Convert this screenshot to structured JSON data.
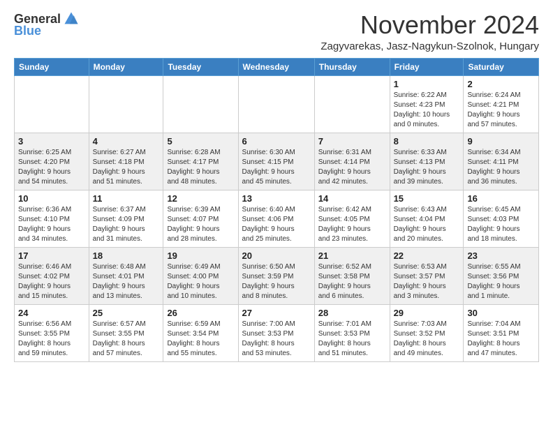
{
  "header": {
    "logo_general": "General",
    "logo_blue": "Blue",
    "month_title": "November 2024",
    "subtitle": "Zagyvarekas, Jasz-Nagykun-Szolnok, Hungary"
  },
  "days_of_week": [
    "Sunday",
    "Monday",
    "Tuesday",
    "Wednesday",
    "Thursday",
    "Friday",
    "Saturday"
  ],
  "weeks": [
    [
      {
        "day": "",
        "info": ""
      },
      {
        "day": "",
        "info": ""
      },
      {
        "day": "",
        "info": ""
      },
      {
        "day": "",
        "info": ""
      },
      {
        "day": "",
        "info": ""
      },
      {
        "day": "1",
        "info": "Sunrise: 6:22 AM\nSunset: 4:23 PM\nDaylight: 10 hours\nand 0 minutes."
      },
      {
        "day": "2",
        "info": "Sunrise: 6:24 AM\nSunset: 4:21 PM\nDaylight: 9 hours\nand 57 minutes."
      }
    ],
    [
      {
        "day": "3",
        "info": "Sunrise: 6:25 AM\nSunset: 4:20 PM\nDaylight: 9 hours\nand 54 minutes."
      },
      {
        "day": "4",
        "info": "Sunrise: 6:27 AM\nSunset: 4:18 PM\nDaylight: 9 hours\nand 51 minutes."
      },
      {
        "day": "5",
        "info": "Sunrise: 6:28 AM\nSunset: 4:17 PM\nDaylight: 9 hours\nand 48 minutes."
      },
      {
        "day": "6",
        "info": "Sunrise: 6:30 AM\nSunset: 4:15 PM\nDaylight: 9 hours\nand 45 minutes."
      },
      {
        "day": "7",
        "info": "Sunrise: 6:31 AM\nSunset: 4:14 PM\nDaylight: 9 hours\nand 42 minutes."
      },
      {
        "day": "8",
        "info": "Sunrise: 6:33 AM\nSunset: 4:13 PM\nDaylight: 9 hours\nand 39 minutes."
      },
      {
        "day": "9",
        "info": "Sunrise: 6:34 AM\nSunset: 4:11 PM\nDaylight: 9 hours\nand 36 minutes."
      }
    ],
    [
      {
        "day": "10",
        "info": "Sunrise: 6:36 AM\nSunset: 4:10 PM\nDaylight: 9 hours\nand 34 minutes."
      },
      {
        "day": "11",
        "info": "Sunrise: 6:37 AM\nSunset: 4:09 PM\nDaylight: 9 hours\nand 31 minutes."
      },
      {
        "day": "12",
        "info": "Sunrise: 6:39 AM\nSunset: 4:07 PM\nDaylight: 9 hours\nand 28 minutes."
      },
      {
        "day": "13",
        "info": "Sunrise: 6:40 AM\nSunset: 4:06 PM\nDaylight: 9 hours\nand 25 minutes."
      },
      {
        "day": "14",
        "info": "Sunrise: 6:42 AM\nSunset: 4:05 PM\nDaylight: 9 hours\nand 23 minutes."
      },
      {
        "day": "15",
        "info": "Sunrise: 6:43 AM\nSunset: 4:04 PM\nDaylight: 9 hours\nand 20 minutes."
      },
      {
        "day": "16",
        "info": "Sunrise: 6:45 AM\nSunset: 4:03 PM\nDaylight: 9 hours\nand 18 minutes."
      }
    ],
    [
      {
        "day": "17",
        "info": "Sunrise: 6:46 AM\nSunset: 4:02 PM\nDaylight: 9 hours\nand 15 minutes."
      },
      {
        "day": "18",
        "info": "Sunrise: 6:48 AM\nSunset: 4:01 PM\nDaylight: 9 hours\nand 13 minutes."
      },
      {
        "day": "19",
        "info": "Sunrise: 6:49 AM\nSunset: 4:00 PM\nDaylight: 9 hours\nand 10 minutes."
      },
      {
        "day": "20",
        "info": "Sunrise: 6:50 AM\nSunset: 3:59 PM\nDaylight: 9 hours\nand 8 minutes."
      },
      {
        "day": "21",
        "info": "Sunrise: 6:52 AM\nSunset: 3:58 PM\nDaylight: 9 hours\nand 6 minutes."
      },
      {
        "day": "22",
        "info": "Sunrise: 6:53 AM\nSunset: 3:57 PM\nDaylight: 9 hours\nand 3 minutes."
      },
      {
        "day": "23",
        "info": "Sunrise: 6:55 AM\nSunset: 3:56 PM\nDaylight: 9 hours\nand 1 minute."
      }
    ],
    [
      {
        "day": "24",
        "info": "Sunrise: 6:56 AM\nSunset: 3:55 PM\nDaylight: 8 hours\nand 59 minutes."
      },
      {
        "day": "25",
        "info": "Sunrise: 6:57 AM\nSunset: 3:55 PM\nDaylight: 8 hours\nand 57 minutes."
      },
      {
        "day": "26",
        "info": "Sunrise: 6:59 AM\nSunset: 3:54 PM\nDaylight: 8 hours\nand 55 minutes."
      },
      {
        "day": "27",
        "info": "Sunrise: 7:00 AM\nSunset: 3:53 PM\nDaylight: 8 hours\nand 53 minutes."
      },
      {
        "day": "28",
        "info": "Sunrise: 7:01 AM\nSunset: 3:53 PM\nDaylight: 8 hours\nand 51 minutes."
      },
      {
        "day": "29",
        "info": "Sunrise: 7:03 AM\nSunset: 3:52 PM\nDaylight: 8 hours\nand 49 minutes."
      },
      {
        "day": "30",
        "info": "Sunrise: 7:04 AM\nSunset: 3:51 PM\nDaylight: 8 hours\nand 47 minutes."
      }
    ]
  ]
}
